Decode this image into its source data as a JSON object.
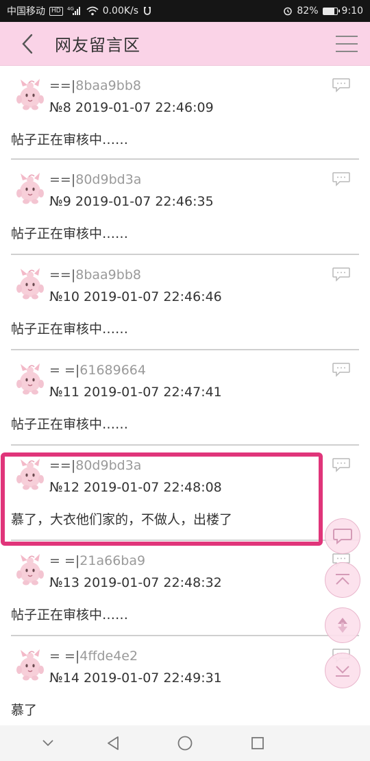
{
  "status_bar": {
    "carrier": "中国移动",
    "hd_chip": "HD",
    "net_type": "4G",
    "speed": "0.00K/s",
    "battery_percent": "82%",
    "battery_level": 0.82,
    "time": "9:10"
  },
  "header": {
    "title": "网友留言区"
  },
  "posts": [
    {
      "prefix": "==|",
      "uid": "8baa9bb8",
      "meta": "№8  2019-01-07 22:46:09",
      "body": "帖子正在审核中……"
    },
    {
      "prefix": "==|",
      "uid": "80d9bd3a",
      "meta": "№9  2019-01-07 22:46:35",
      "body": "帖子正在审核中……"
    },
    {
      "prefix": "==|",
      "uid": "8baa9bb8",
      "meta": "№10  2019-01-07 22:46:46",
      "body": "帖子正在审核中……"
    },
    {
      "prefix": "= =|",
      "uid": "61689664",
      "meta": "№11  2019-01-07 22:47:41",
      "body": "帖子正在审核中……"
    },
    {
      "prefix": "==|",
      "uid": "80d9bd3a",
      "meta": "№12  2019-01-07 22:48:08",
      "body": "慕了，大衣他们家的，不做人，出楼了"
    },
    {
      "prefix": "= =|",
      "uid": "21a66ba9",
      "meta": "№13  2019-01-07 22:48:32",
      "body": "帖子正在审核中……"
    },
    {
      "prefix": "= =|",
      "uid": "4ffde4e2",
      "meta": "№14  2019-01-07 22:49:31",
      "body": "慕了"
    }
  ],
  "colors": {
    "header_bg": "#fad3e7",
    "highlight_border": "#e0357a",
    "uid_text": "#9a9a9a"
  },
  "floating_buttons": [
    "reply-icon",
    "scroll-top-icon",
    "refresh-icon",
    "scroll-bottom-icon"
  ]
}
